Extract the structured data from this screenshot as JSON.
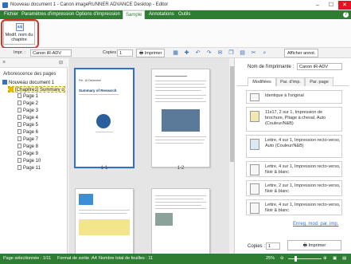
{
  "window": {
    "title": "Nouveau document 1 - Canon imageRUNNER ADVANCE Desktop - Editor",
    "controls": {
      "minimize": "–",
      "maximize": "☐",
      "close": "✕"
    }
  },
  "menu": {
    "items": [
      "Fichier",
      "Paramètres d'impression",
      "Options d'impression",
      "Sample",
      "Annotations",
      "Outils"
    ],
    "active_index": 3,
    "help": "?"
  },
  "ribbon": {
    "button_label": "Modif. nom du chapitre",
    "button_icon": "aa|",
    "group_label": "Sample"
  },
  "toolbar": {
    "printer_label": "Impr. :",
    "printer_value": "Canon iR-ADV",
    "copies_label": "Copies :",
    "copies_value": "1",
    "print_label": "Imprimer",
    "show_annot": "Afficher annot."
  },
  "left_pane": {
    "tree_title": "Arborescence des pages",
    "document": "Nouveau document 1",
    "chapter": "[Chapitre1] Summary o",
    "pages": [
      "Page 1",
      "Page 2",
      "Page 3",
      "Page 4",
      "Page 5",
      "Page 6",
      "Page 7",
      "Page 8",
      "Page 9",
      "Page 10",
      "Page 11"
    ]
  },
  "center_pane": {
    "page_labels": [
      "1-1",
      "1-2"
    ],
    "thumb1": {
      "heading": "Summary of Research",
      "org": "Per. 16 December"
    }
  },
  "right_pane": {
    "printer_name_label": "Nom de l'imprimante :",
    "printer_name_value": "Canon iR-ADV",
    "tabs": [
      "Modifiées",
      "Par. d'imp.",
      "Par. page"
    ],
    "settings": [
      "Identique à l'original",
      "11x17, 2 sur 1, Impression de brochure, Pliage à cheval, Auto (Couleur/N&B)",
      "Lettre, 4 sur 1, Impression recto-verso, Auto (Couleur/N&B)",
      "Lettre, 4 sur 1, Impression recto-verso, Noir & blanc",
      "Lettre, 2 sur 1, Impression recto-verso, Noir & blanc",
      "Lettre, 4 sur 1, Impression recto-verso, Noir & blanc"
    ],
    "link": "Enreg. mod. par. imp.",
    "copies_label": "Copies :",
    "copies_value": "1",
    "print_button": "Imprimer"
  },
  "status": {
    "selected_page": "Page sélectionnée : 1/11",
    "format": "Format de sortie :A4",
    "total_sheets": "Nombre total de feuilles : 11",
    "zoom": "25%"
  }
}
